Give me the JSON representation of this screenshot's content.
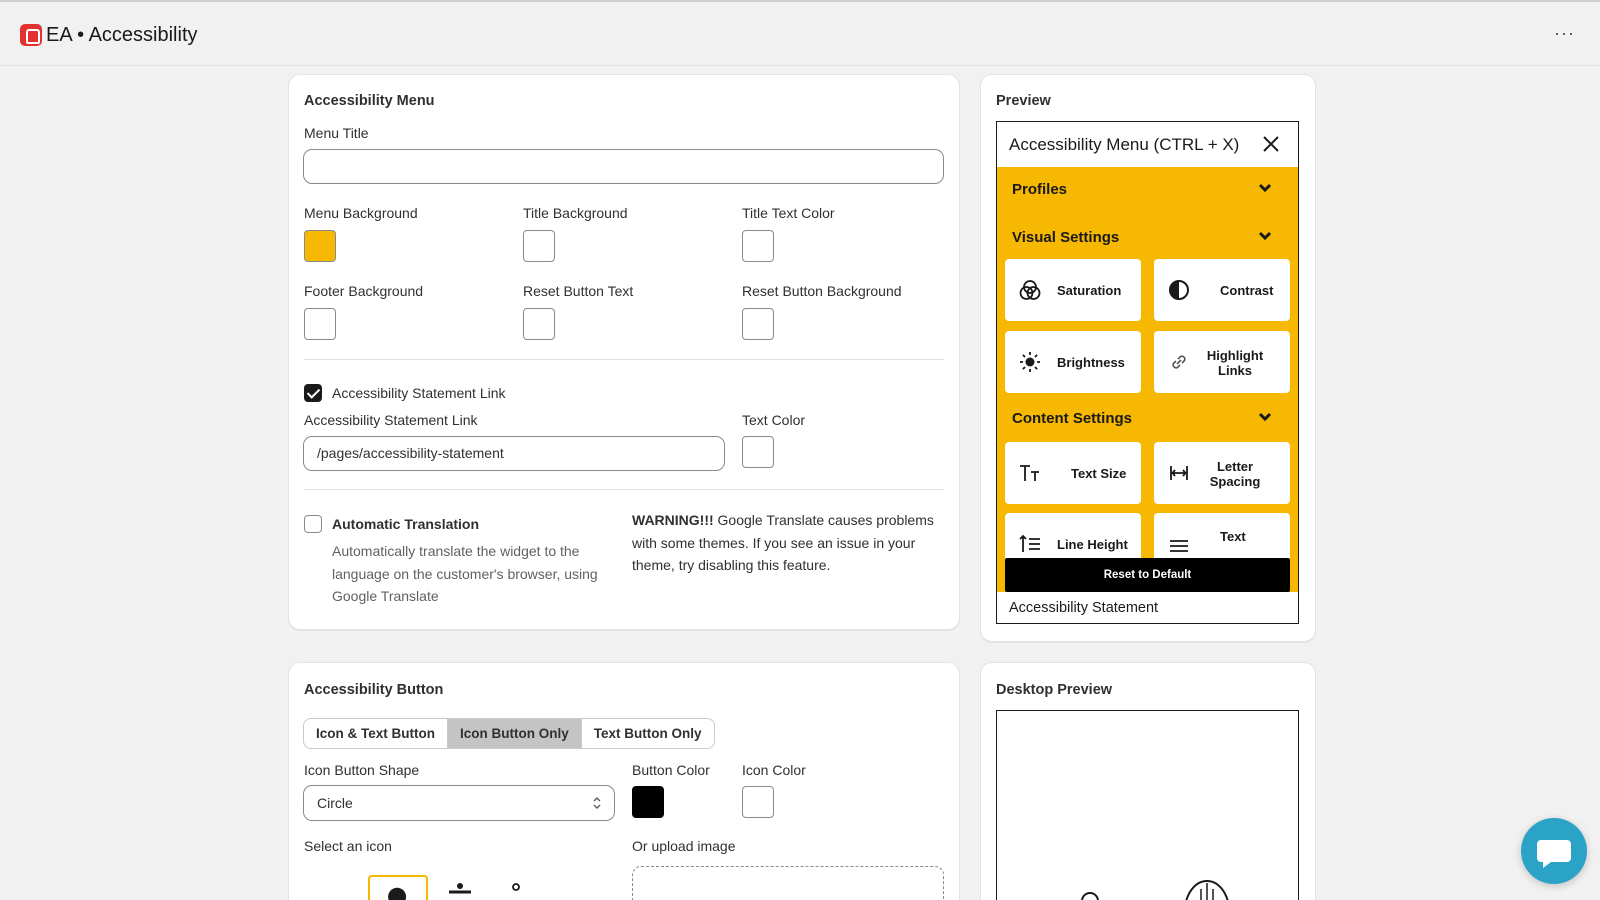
{
  "app": {
    "title": "EA • Accessibility",
    "more": "···"
  },
  "menu_card": {
    "title": "Accessibility Menu",
    "menu_title_label": "Menu Title",
    "menu_title_value": "",
    "colors": [
      {
        "label": "Menu Background",
        "value": "#f6b800"
      },
      {
        "label": "Title Background",
        "value": "#ffffff"
      },
      {
        "label": "Title Text Color",
        "value": "#ffffff"
      },
      {
        "label": "Footer Background",
        "value": "#ffffff"
      },
      {
        "label": "Reset Button Text",
        "value": "#ffffff"
      },
      {
        "label": "Reset Button Background",
        "value": "#ffffff"
      }
    ],
    "statement_checkbox_label": "Accessibility Statement Link",
    "statement_checked": true,
    "statement_link_label": "Accessibility Statement Link",
    "statement_link_value": "/pages/accessibility-statement",
    "text_color_label": "Text Color",
    "translation_label": "Automatic Translation",
    "translation_checked": false,
    "translation_help": "Automatically translate the widget to the language on the customer's browser, using Google Translate",
    "warning_bold": "WARNING!!!",
    "warning_text": " Google Translate causes problems with some themes. If you see an issue in your theme, try disabling this feature."
  },
  "preview_card": {
    "title": "Preview",
    "widget_title": "Accessibility Menu (CTRL + X)",
    "sections": [
      "Profiles",
      "Visual Settings",
      "Content Settings"
    ],
    "tiles": [
      {
        "label": "Saturation",
        "icon": "saturation-icon"
      },
      {
        "label": "Contrast",
        "icon": "contrast-icon"
      },
      {
        "label": "Brightness",
        "icon": "brightness-icon"
      },
      {
        "label": "Highlight Links",
        "icon": "link-icon"
      },
      {
        "label": "Text Size",
        "icon": "text-size-icon"
      },
      {
        "label": "Letter Spacing",
        "icon": "letter-spacing-icon"
      },
      {
        "label": "Line Height",
        "icon": "line-height-icon"
      },
      {
        "label": "Text",
        "icon": "text-align-icon"
      }
    ],
    "reset_label": "Reset to Default",
    "footer_text": "Accessibility Statement",
    "accent": "#f6b800"
  },
  "button_card": {
    "title": "Accessibility Button",
    "modes": [
      "Icon & Text Button",
      "Icon Button Only",
      "Text Button Only"
    ],
    "active_mode": "Icon Button Only",
    "shape_label": "Icon Button Shape",
    "shape_value": "Circle",
    "button_color_label": "Button Color",
    "button_color": "#000000",
    "icon_color_label": "Icon Color",
    "icon_color": "#ffffff",
    "select_icon_label": "Select an icon",
    "upload_label": "Or upload image"
  },
  "desktop_card": {
    "title": "Desktop Preview"
  }
}
